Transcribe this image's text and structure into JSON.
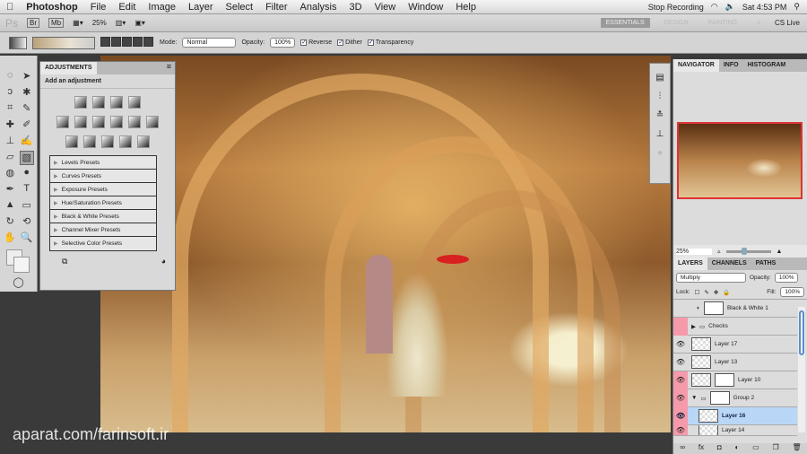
{
  "menubar": {
    "app": "Photoshop",
    "items": [
      "File",
      "Edit",
      "Image",
      "Layer",
      "Select",
      "Filter",
      "Analysis",
      "3D",
      "View",
      "Window",
      "Help"
    ],
    "status": {
      "recording": "Stop Recording",
      "time": "Sat 4:53 PM"
    }
  },
  "appbar": {
    "logo": "Ps",
    "br": "Br",
    "mb": "Mb",
    "zoom": "25%",
    "workspaces": [
      "ESSENTIALS",
      "DESIGN",
      "PAINTING"
    ],
    "more": "»",
    "cslive": "CS Live"
  },
  "options": {
    "mode_label": "Mode:",
    "mode": "Normal",
    "opacity_label": "Opacity:",
    "opacity": "100%",
    "reverse": "Reverse",
    "dither": "Dither",
    "transparency": "Transparency",
    "checked": true
  },
  "adjustments": {
    "tab": "ADJUSTMENTS",
    "subtitle": "Add an adjustment",
    "presets": [
      "Levels Presets",
      "Curves Presets",
      "Exposure Presets",
      "Hue/Saturation Presets",
      "Black & White Presets",
      "Channel Mixer Presets",
      "Selective Color Presets"
    ]
  },
  "navigator": {
    "tabs": [
      "NAVIGATOR",
      "INFO",
      "HISTOGRAM"
    ],
    "zoom": "25%",
    "zoom_fraction": 0.35
  },
  "layers": {
    "tabs": [
      "LAYERS",
      "CHANNELS",
      "PATHS"
    ],
    "blend": "Multiply",
    "opacity_label": "Opacity:",
    "opacity": "100%",
    "lock_label": "Lock:",
    "fill_label": "Fill:",
    "fill": "100%",
    "rows": [
      {
        "name": "Black & White 1",
        "visible": false
      },
      {
        "name": "Checks",
        "visible": false
      },
      {
        "name": "Layer 17",
        "visible": true
      },
      {
        "name": "Layer 13",
        "visible": true
      },
      {
        "name": "Layer 10",
        "visible": true
      },
      {
        "name": "Group 2",
        "visible": true
      },
      {
        "name": "Layer 16",
        "visible": true,
        "selected": true
      },
      {
        "name": "Layer 14",
        "visible": true
      }
    ]
  },
  "watermark": "aparat.com/farinsoft.ir"
}
